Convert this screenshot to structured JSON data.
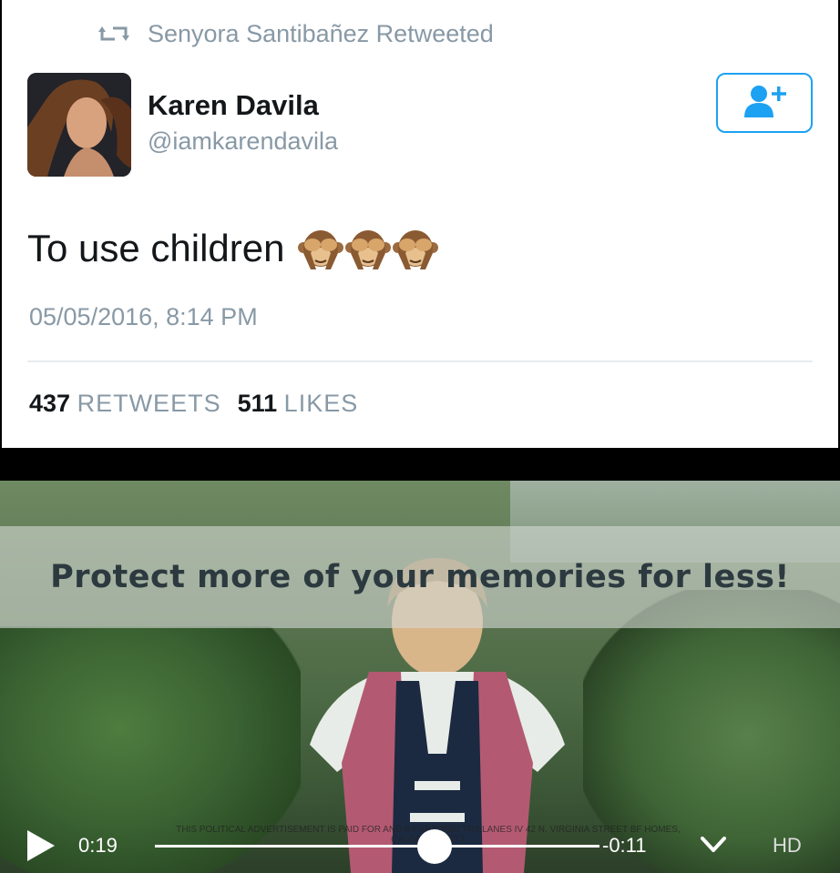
{
  "tweet": {
    "retweeted_by": "Senyora Santibañez Retweeted",
    "author_name": "Karen Davila",
    "author_handle": "@iamkarendavila",
    "text": "To use children",
    "emoji": [
      "see-no-evil-monkey",
      "see-no-evil-monkey",
      "see-no-evil-monkey"
    ],
    "timestamp": "05/05/2016, 8:14 PM",
    "retweets_count": "437",
    "retweets_label": "RETWEETS",
    "likes_count": "511",
    "likes_label": "LIKES",
    "follow_icon": "add-user-icon",
    "accent_color": "#1da1f2"
  },
  "video": {
    "banner_text": "Protect more of your memories for less!",
    "disclaimer": "THIS POLITICAL ADVERTISEMENT IS PAID FOR AND BY ANTONIO TRILLANES IV 42 N. VIRGINIA STREET BF HOMES, CALOOCAN CITY",
    "elapsed": "0:19",
    "remaining": "-0:11",
    "progress": 0.63,
    "quality_label": "HD"
  }
}
